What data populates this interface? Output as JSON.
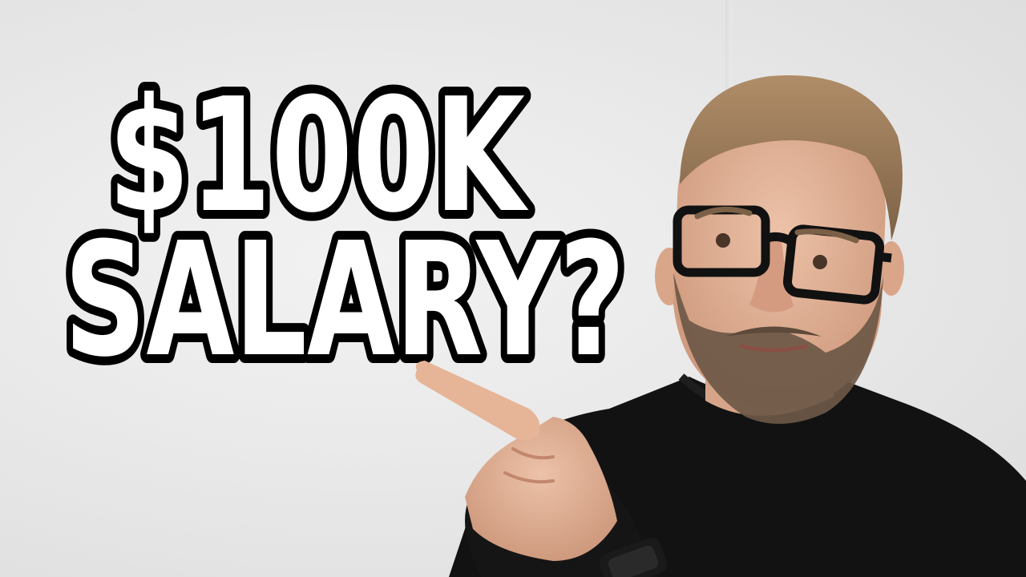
{
  "thumbnail": {
    "headline_line1": "$100K",
    "headline_line2": "SALARY?",
    "colors": {
      "text_fill": "#ffffff",
      "text_stroke": "#000000",
      "background": "#e6e6e6",
      "shirt": "#121212",
      "skin": "#e2b49a",
      "hair": "#9a7a58",
      "beard": "#6d5846"
    }
  }
}
